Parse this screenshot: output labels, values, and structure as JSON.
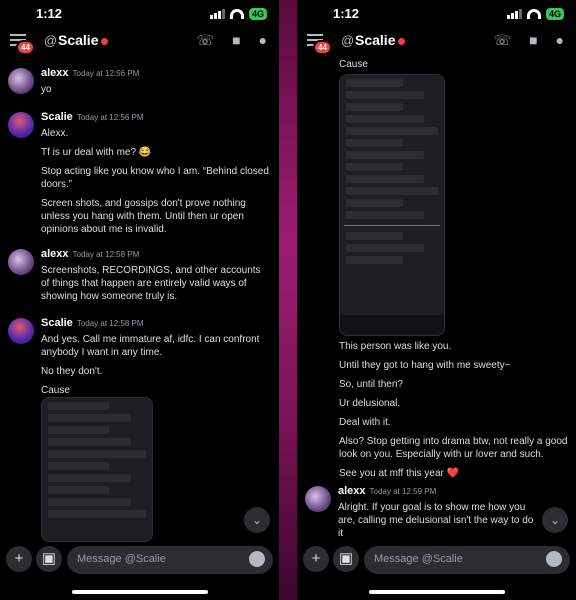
{
  "status": {
    "time": "1:12",
    "network": "4G"
  },
  "header": {
    "at_symbol": "@",
    "title": "Scalie",
    "unread_badge": "44"
  },
  "left": {
    "messages": [
      {
        "author": "alexx",
        "timestamp": "Today at 12:56 PM",
        "lines": [
          "yo"
        ]
      },
      {
        "author": "Scalie",
        "timestamp": "Today at 12:56 PM",
        "lines": [
          "Alexx.",
          "Tf is ur deal with me? 😂",
          "Stop acting like you know who I am. “Behind closed doors.”",
          "Screen shots, and gossips don't prove nothing unless you hang with them. Until then ur open opinions about me is invalid."
        ]
      },
      {
        "author": "alexx",
        "timestamp": "Today at 12:58 PM",
        "lines": [
          "Screenshots, RECORDINGS, and other accounts of things that happen are entirely valid ways of showing how someone truly is."
        ]
      },
      {
        "author": "Scalie",
        "timestamp": "Today at 12:58 PM",
        "lines": [
          "And yes. Call me immature af, idfc. I can confront anybody I want in any time.",
          "No they don't.",
          "Cause"
        ]
      }
    ]
  },
  "right": {
    "top_text": "Cause",
    "lines": [
      "This person was like you.",
      "Until they got to hang with me sweety~",
      "So, until then?",
      "Ur delusional.",
      "Deal with it.",
      "Also? Stop getting into drama btw, not really a good look on you. Especially with ur lover and such.",
      "See you at mff this year ❤️"
    ],
    "last_message": {
      "author": "alexx",
      "timestamp": "Today at 12:59 PM",
      "lines": [
        "Alright. If your goal is to show me how you are, calling me delusional isn't the way to do it"
      ]
    }
  },
  "composer": {
    "placeholder": "Message @Scalie"
  },
  "icons": {
    "menu": "hamburger-icon",
    "call": "phone-icon",
    "video": "video-camera-icon",
    "members": "members-icon",
    "add": "plus-icon",
    "gift": "gift-icon",
    "emoji": "emoji-icon",
    "jump": "chevron-down-icon"
  },
  "colors": {
    "background": "#000000",
    "divider": "#9d1c72",
    "dnd_status": "#f23f43",
    "network_badge": "#34c759"
  }
}
